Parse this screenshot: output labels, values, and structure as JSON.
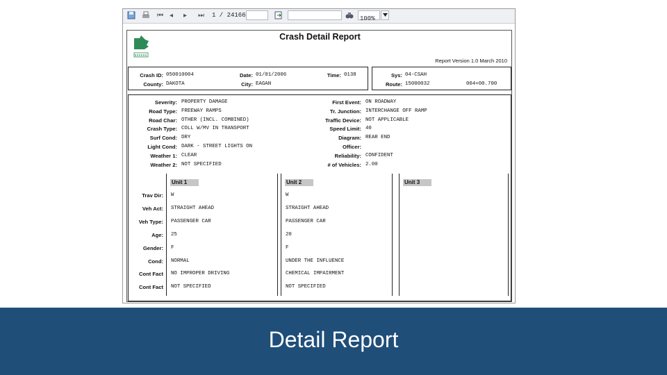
{
  "toolbar": {
    "page_indicator": "1 / 24166",
    "zoom": "100%"
  },
  "report": {
    "title": "Crash Detail Report",
    "version": "Report Version 1.0 March 2010",
    "header": {
      "crash_id_label": "Crash ID:",
      "crash_id": "050010004",
      "date_label": "Date:",
      "date": "01/01/2006",
      "time_label": "Time:",
      "time": "0138",
      "sys_label": "Sys:",
      "sys": "04-CSAH",
      "county_label": "County:",
      "county": "DAKOTA",
      "city_label": "City:",
      "city": "EAGAN",
      "route_label": "Route:",
      "route": "15000032",
      "ref_point": "004+00.700"
    },
    "left_fields": [
      {
        "label": "Severity:",
        "value": "PROPERTY DAMAGE"
      },
      {
        "label": "Road Type:",
        "value": "FREEWAY RAMPS"
      },
      {
        "label": "Road Char:",
        "value": "OTHER (INCL. COMBINED)"
      },
      {
        "label": "Crash Type:",
        "value": "COLL W/MV IN TRANSPORT"
      },
      {
        "label": "Surf Cond:",
        "value": "DRY"
      },
      {
        "label": "Light Cond:",
        "value": "DARK - STREET LIGHTS ON"
      },
      {
        "label": "Weather 1:",
        "value": "CLEAR"
      },
      {
        "label": "Weather 2:",
        "value": "NOT SPECIFIED"
      }
    ],
    "right_fields": [
      {
        "label": "First Event:",
        "value": "ON ROADWAY"
      },
      {
        "label": "Tr. Junction:",
        "value": "INTERCHANGE OFF RAMP"
      },
      {
        "label": "Traffic Device:",
        "value": "NOT APPLICABLE"
      },
      {
        "label": "Speed Limit:",
        "value": "40"
      },
      {
        "label": "Diagram:",
        "value": "REAR END"
      },
      {
        "label": "Officer:",
        "value": ""
      },
      {
        "label": "Reliability:",
        "value": "CONFIDENT"
      },
      {
        "label": "# of Vehicles:",
        "value": "2.00"
      }
    ],
    "unit_row_labels": [
      "Trav Dir:",
      "Veh Act:",
      "Veh Type:",
      "Age:",
      "Gender:",
      "Cond:",
      "Cont Fact",
      "Cont Fact"
    ],
    "units": [
      {
        "title": "Unit 1",
        "values": [
          "W",
          "STRAIGHT AHEAD",
          "PASSENGER CAR",
          "25",
          "F",
          "NORMAL",
          "NO IMPROPER DRIVING",
          "NOT SPECIFIED"
        ]
      },
      {
        "title": "Unit 2",
        "values": [
          "W",
          "STRAIGHT AHEAD",
          "PASSENGER CAR",
          "20",
          "F",
          "UNDER THE INFLUENCE",
          "CHEMICAL IMPAIRMENT",
          "NOT SPECIFIED"
        ]
      },
      {
        "title": "Unit 3",
        "values": [
          "",
          "",
          "",
          "",
          "",
          "",
          "",
          ""
        ]
      }
    ]
  },
  "slide_title": "Detail Report",
  "colors": {
    "banner": "#1f4e79",
    "unit_header": "#c6c6c6",
    "logo": "#2e8b57"
  }
}
